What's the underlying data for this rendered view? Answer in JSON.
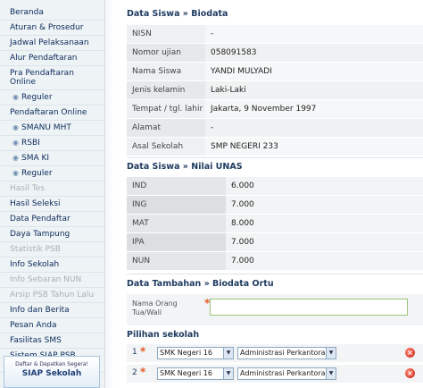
{
  "sidebar": {
    "items": [
      {
        "label": "Beranda",
        "sub": false,
        "disabled": false
      },
      {
        "label": "Aturan & Prosedur",
        "sub": false,
        "disabled": false
      },
      {
        "label": "Jadwal Pelaksanaan",
        "sub": false,
        "disabled": false
      },
      {
        "label": "Alur Pendaftaran",
        "sub": false,
        "disabled": false
      },
      {
        "label": "Pra Pendaftaran Online",
        "sub": false,
        "disabled": false
      },
      {
        "label": "Reguler",
        "sub": true,
        "disabled": false
      },
      {
        "label": "Pendaftaran Online",
        "sub": false,
        "disabled": false
      },
      {
        "label": "SMANU MHT",
        "sub": true,
        "disabled": false
      },
      {
        "label": "RSBI",
        "sub": true,
        "disabled": false
      },
      {
        "label": "SMA KI",
        "sub": true,
        "disabled": false
      },
      {
        "label": "Reguler",
        "sub": true,
        "disabled": false
      },
      {
        "label": "Hasil Tes",
        "sub": false,
        "disabled": true
      },
      {
        "label": "Hasil Seleksi",
        "sub": false,
        "disabled": false
      },
      {
        "label": "Data Pendaftar",
        "sub": false,
        "disabled": false
      },
      {
        "label": "Daya Tampung",
        "sub": false,
        "disabled": false
      },
      {
        "label": "Statistik PSB",
        "sub": false,
        "disabled": true
      },
      {
        "label": "Info Sekolah",
        "sub": false,
        "disabled": false
      },
      {
        "label": "Info Sebaran NUN",
        "sub": false,
        "disabled": true
      },
      {
        "label": "Arsip PSB Tahun Lalu",
        "sub": false,
        "disabled": true
      },
      {
        "label": "Info dan Berita",
        "sub": false,
        "disabled": false
      },
      {
        "label": "Pesan Anda",
        "sub": false,
        "disabled": false
      },
      {
        "label": "Fasilitas SMS",
        "sub": false,
        "disabled": false
      },
      {
        "label": "Sistem SIAP PSB Online",
        "sub": false,
        "disabled": false
      }
    ],
    "promo": {
      "line1": "Daftar & Dapatkan Segera!",
      "line2": "SIAP Sekolah"
    }
  },
  "biodata": {
    "title": "Data Siswa » Biodata",
    "rows": [
      {
        "label": "NISN",
        "value": "-"
      },
      {
        "label": "Nomor ujian",
        "value": "058091583"
      },
      {
        "label": "Nama Siswa",
        "value": "YANDI MULYADI"
      },
      {
        "label": "Jenis kelamin",
        "value": "Laki-Laki"
      },
      {
        "label": "Tempat / tgl. lahir",
        "value": "Jakarta, 9 November 1997"
      },
      {
        "label": "Alamat",
        "value": "-"
      },
      {
        "label": "Asal Sekolah",
        "value": "SMP NEGERI 233"
      }
    ]
  },
  "unas": {
    "title": "Data Siswa » Nilai UNAS",
    "rows": [
      {
        "label": "IND",
        "value": "6.000"
      },
      {
        "label": "ING",
        "value": "7.000"
      },
      {
        "label": "MAT",
        "value": "8.000"
      },
      {
        "label": "IPA",
        "value": "7.000"
      },
      {
        "label": "NUN",
        "value": "7.000"
      }
    ]
  },
  "ortu": {
    "title": "Data Tambahan » Biodata Ortu",
    "label": "Nama Orang Tua/Wali",
    "required": "*",
    "value": ""
  },
  "pilihan": {
    "title": "Pilihan sekolah",
    "rows": [
      {
        "num": "1",
        "required": "*",
        "school": "SMK Negeri 16",
        "program": "Administrasi Perkantoran"
      },
      {
        "num": "2",
        "required": "*",
        "school": "SMK Negeri 16",
        "program": "Administrasi Perkantoran"
      }
    ]
  }
}
